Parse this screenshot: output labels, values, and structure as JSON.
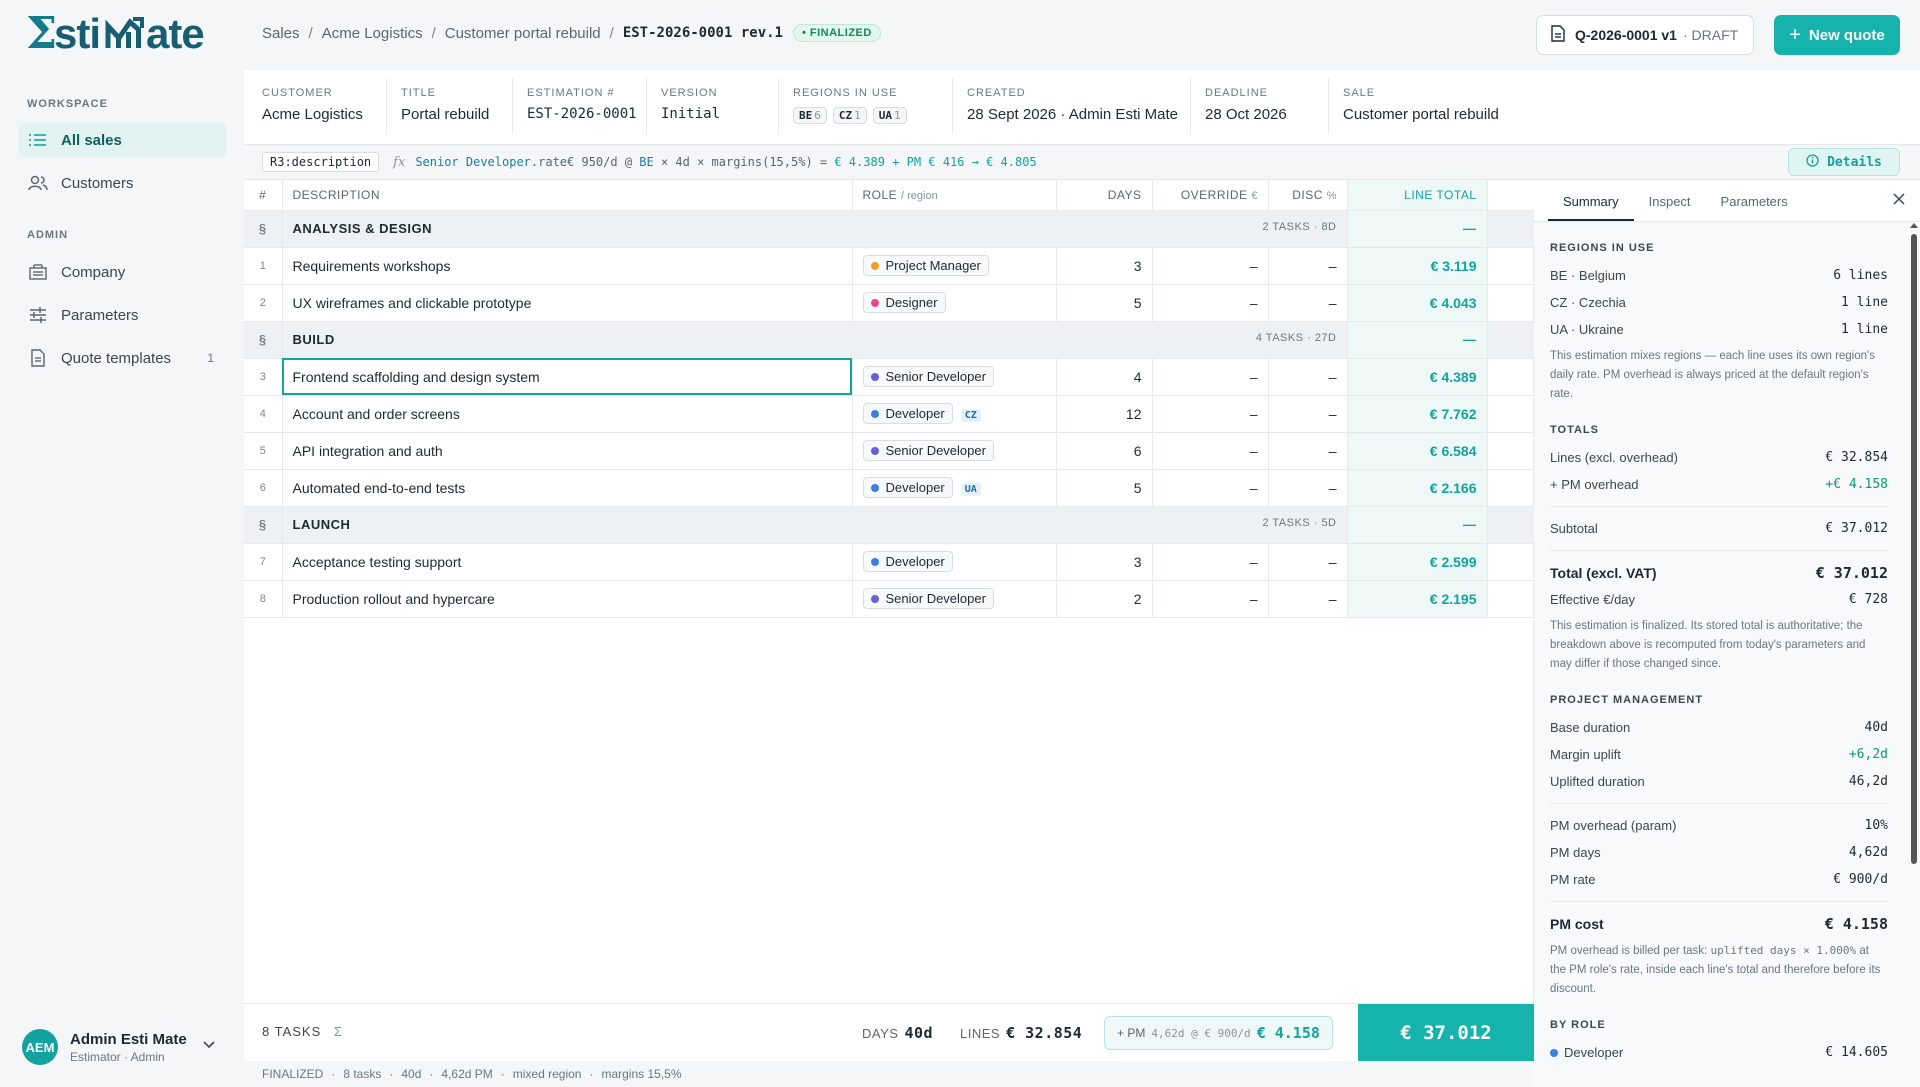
{
  "app": {
    "brand": "Estimate"
  },
  "sidebar": {
    "workspace_label": "WORKSPACE",
    "admin_label": "ADMIN",
    "items": [
      {
        "label": "All sales",
        "icon": "list-icon"
      },
      {
        "label": "Customers",
        "icon": "users-icon"
      },
      {
        "label": "Company",
        "icon": "building-icon"
      },
      {
        "label": "Parameters",
        "icon": "sliders-icon"
      },
      {
        "label": "Quote templates",
        "icon": "document-icon",
        "count": "1"
      }
    ],
    "user": {
      "initials": "AEM",
      "name": "Admin Esti Mate",
      "role": "Estimator · Admin"
    }
  },
  "breadcrumb": {
    "items": [
      "Sales",
      "Acme Logistics",
      "Customer portal rebuild"
    ],
    "current": "EST-2026-0001 rev.1",
    "status": "• FINALIZED"
  },
  "header": {
    "quote_id": "Q-2026-0001 v1",
    "quote_status": "· DRAFT",
    "new_quote_label": "New quote"
  },
  "meta": {
    "customer_label": "CUSTOMER",
    "customer": "Acme Logistics",
    "title_label": "TITLE",
    "title": "Portal rebuild",
    "estnum_label": "ESTIMATION #",
    "estnum": "EST-2026-0001",
    "version_label": "VERSION",
    "version": "Initial",
    "regions_label": "REGIONS IN USE",
    "regions": [
      {
        "code": "BE",
        "count": "6"
      },
      {
        "code": "CZ",
        "count": "1"
      },
      {
        "code": "UA",
        "count": "1"
      }
    ],
    "created_label": "CREATED",
    "created": "28 Sept 2026 · Admin Esti Mate",
    "deadline_label": "DEADLINE",
    "deadline": "28 Oct 2026",
    "sale_label": "SALE",
    "sale": "Customer portal rebuild"
  },
  "formula_bar": {
    "cell": "R3:description",
    "fx": "fx",
    "role": "Senior Developer",
    "expr_a": ".rate€ 950/d @ ",
    "region": "BE",
    "expr_b": " × 4d × margins(15,5%) = ",
    "result": "€ 4.389 + PM € 416 → € 4.805",
    "details_label": "Details"
  },
  "grid": {
    "headers": {
      "idx": "#",
      "desc": "DESCRIPTION",
      "role": "ROLE",
      "role_sub": "/ region",
      "days": "DAYS",
      "override": "OVERRIDE",
      "override_sub": "€",
      "disc": "DISC",
      "disc_sub": "%",
      "total": "LINE TOTAL"
    },
    "section_marker": "§",
    "sections": [
      {
        "name": "ANALYSIS & DESIGN",
        "summary": "2 TASKS · 8D",
        "total": "—",
        "rows": [
          {
            "n": "1",
            "desc": "Requirements workshops",
            "role": "Project Manager",
            "color": "#f0a020",
            "region": "",
            "days": "3",
            "override": "–",
            "disc": "–",
            "total": "€ 3.119"
          },
          {
            "n": "2",
            "desc": "UX wireframes and clickable prototype",
            "role": "Designer",
            "color": "#e8458f",
            "region": "",
            "days": "5",
            "override": "–",
            "disc": "–",
            "total": "€ 4.043"
          }
        ]
      },
      {
        "name": "BUILD",
        "summary": "4 TASKS · 27D",
        "total": "—",
        "rows": [
          {
            "n": "3",
            "desc": "Frontend scaffolding and design system",
            "role": "Senior Developer",
            "color": "#6a5fd8",
            "region": "",
            "days": "4",
            "override": "–",
            "disc": "–",
            "total": "€ 4.389",
            "selected": true
          },
          {
            "n": "4",
            "desc": "Account and order screens",
            "role": "Developer",
            "color": "#3b7fe0",
            "region": "CZ",
            "days": "12",
            "override": "–",
            "disc": "–",
            "total": "€ 7.762"
          },
          {
            "n": "5",
            "desc": "API integration and auth",
            "role": "Senior Developer",
            "color": "#6a5fd8",
            "region": "",
            "days": "6",
            "override": "–",
            "disc": "–",
            "total": "€ 6.584"
          },
          {
            "n": "6",
            "desc": "Automated end-to-end tests",
            "role": "Developer",
            "color": "#3b7fe0",
            "region": "UA",
            "days": "5",
            "override": "–",
            "disc": "–",
            "total": "€ 2.166"
          }
        ]
      },
      {
        "name": "LAUNCH",
        "summary": "2 TASKS · 5D",
        "total": "—",
        "rows": [
          {
            "n": "7",
            "desc": "Acceptance testing support",
            "role": "Developer",
            "color": "#3b7fe0",
            "region": "",
            "days": "3",
            "override": "–",
            "disc": "–",
            "total": "€ 2.599"
          },
          {
            "n": "8",
            "desc": "Production rollout and hypercare",
            "role": "Senior Developer",
            "color": "#6a5fd8",
            "region": "",
            "days": "2",
            "override": "–",
            "disc": "–",
            "total": "€ 2.195"
          }
        ]
      }
    ]
  },
  "footer": {
    "tasks": "8 TASKS",
    "sigma": "Σ",
    "days_label": "DAYS",
    "days": "40d",
    "lines_label": "LINES",
    "lines": "€ 32.854",
    "pm_label": "+ PM",
    "pm_sub": "4,62d @ € 900/d",
    "pm_value": "€ 4.158",
    "grand_total": "€ 37.012"
  },
  "statusbar": [
    "FINALIZED",
    "8 tasks",
    "40d",
    "4,62d PM",
    "mixed region",
    "margins 15,5%"
  ],
  "panel": {
    "tabs": [
      "Summary",
      "Inspect",
      "Parameters"
    ],
    "regions_title": "REGIONS IN USE",
    "regions": [
      {
        "name": "BE · Belgium",
        "value": "6 lines"
      },
      {
        "name": "CZ · Czechia",
        "value": "1 line"
      },
      {
        "name": "UA · Ukraine",
        "value": "1 line"
      }
    ],
    "regions_note": "This estimation mixes regions — each line uses its own region's daily rate. PM overhead is always priced at the default region's rate.",
    "totals_title": "TOTALS",
    "lines_label": "Lines (excl. overhead)",
    "lines_value": "€ 32.854",
    "pm_label": "+ PM overhead",
    "pm_value": "+€ 4.158",
    "subtotal_label": "Subtotal",
    "subtotal_value": "€ 37.012",
    "total_label": "Total (excl. VAT)",
    "total_value": "€ 37.012",
    "eff_label": "Effective €/day",
    "eff_value": "€ 728",
    "totals_note": "This estimation is finalized. Its stored total is authoritative; the breakdown above is recomputed from today's parameters and may differ if those changed since.",
    "pm_title": "PROJECT MANAGEMENT",
    "base_label": "Base duration",
    "base_value": "40d",
    "margin_label": "Margin uplift",
    "margin_value": "+6,2d",
    "uplifted_label": "Uplifted duration",
    "uplifted_value": "46,2d",
    "pmparam_label": "PM overhead (param)",
    "pmparam_value": "10%",
    "pmdays_label": "PM days",
    "pmdays_value": "4,62d",
    "pmrate_label": "PM rate",
    "pmrate_value": "€ 900/d",
    "pmcost_label": "PM cost",
    "pmcost_value": "€ 4.158",
    "pm_note_a": "PM overhead is billed per task: ",
    "pm_note_code": "uplifted days × 1.000%",
    "pm_note_b": " at the PM role's rate, inside each line's total and therefore before its discount.",
    "byrole_title": "BY ROLE",
    "byrole": [
      {
        "name": "Developer",
        "value": "€ 14.605"
      }
    ]
  }
}
